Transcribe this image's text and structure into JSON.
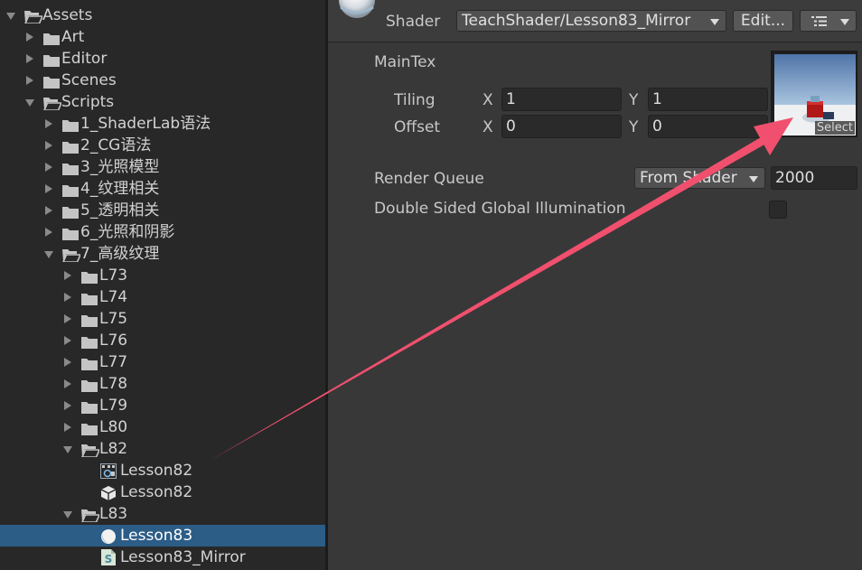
{
  "tree": [
    {
      "label": "Assets",
      "depth": 0,
      "expand": "down",
      "icon": "folder-open-icon",
      "type": "folder-open"
    },
    {
      "label": "Art",
      "depth": 1,
      "expand": "right",
      "icon": "folder-icon",
      "type": "folder"
    },
    {
      "label": "Editor",
      "depth": 1,
      "expand": "right",
      "icon": "folder-icon",
      "type": "folder"
    },
    {
      "label": "Scenes",
      "depth": 1,
      "expand": "right",
      "icon": "folder-icon",
      "type": "folder"
    },
    {
      "label": "Scripts",
      "depth": 1,
      "expand": "down",
      "icon": "folder-open-icon",
      "type": "folder-open"
    },
    {
      "label": "1_ShaderLab语法",
      "depth": 2,
      "expand": "right",
      "icon": "folder-icon",
      "type": "folder"
    },
    {
      "label": "2_CG语法",
      "depth": 2,
      "expand": "right",
      "icon": "folder-icon",
      "type": "folder"
    },
    {
      "label": "3_光照模型",
      "depth": 2,
      "expand": "right",
      "icon": "folder-icon",
      "type": "folder"
    },
    {
      "label": "4_纹理相关",
      "depth": 2,
      "expand": "right",
      "icon": "folder-icon",
      "type": "folder"
    },
    {
      "label": "5_透明相关",
      "depth": 2,
      "expand": "right",
      "icon": "folder-icon",
      "type": "folder"
    },
    {
      "label": "6_光照和阴影",
      "depth": 2,
      "expand": "right",
      "icon": "folder-icon",
      "type": "folder"
    },
    {
      "label": "7_高级纹理",
      "depth": 2,
      "expand": "down",
      "icon": "folder-open-icon",
      "type": "folder-open"
    },
    {
      "label": "L73",
      "depth": 3,
      "expand": "right",
      "icon": "folder-icon",
      "type": "folder"
    },
    {
      "label": "L74",
      "depth": 3,
      "expand": "right",
      "icon": "folder-icon",
      "type": "folder"
    },
    {
      "label": "L75",
      "depth": 3,
      "expand": "right",
      "icon": "folder-icon",
      "type": "folder"
    },
    {
      "label": "L76",
      "depth": 3,
      "expand": "right",
      "icon": "folder-icon",
      "type": "folder"
    },
    {
      "label": "L77",
      "depth": 3,
      "expand": "right",
      "icon": "folder-icon",
      "type": "folder"
    },
    {
      "label": "L78",
      "depth": 3,
      "expand": "right",
      "icon": "folder-icon",
      "type": "folder"
    },
    {
      "label": "L79",
      "depth": 3,
      "expand": "right",
      "icon": "folder-icon",
      "type": "folder"
    },
    {
      "label": "L80",
      "depth": 3,
      "expand": "right",
      "icon": "folder-icon",
      "type": "folder"
    },
    {
      "label": "L82",
      "depth": 3,
      "expand": "down",
      "icon": "folder-open-icon",
      "type": "folder-open"
    },
    {
      "label": "Lesson82",
      "depth": 4,
      "expand": "none",
      "icon": "scene-icon",
      "type": "scene"
    },
    {
      "label": "Lesson82",
      "depth": 4,
      "expand": "none",
      "icon": "prefab-cube-icon",
      "type": "cube"
    },
    {
      "label": "L83",
      "depth": 3,
      "expand": "down",
      "icon": "folder-open-icon",
      "type": "folder-open"
    },
    {
      "label": "Lesson83",
      "depth": 4,
      "expand": "none",
      "icon": "material-sphere-icon",
      "type": "sphere",
      "selected": true
    },
    {
      "label": "Lesson83_Mirror",
      "depth": 4,
      "expand": "none",
      "icon": "shader-file-icon",
      "type": "shader"
    }
  ],
  "inspector": {
    "shader_label": "Shader",
    "shader_value": "TeachShader/Lesson83_Mirror",
    "edit_button": "Edit...",
    "menu_icon": "list-menu-icon",
    "maintex_label": "MainTex",
    "tiling_label": "Tiling",
    "offset_label": "Offset",
    "x_label": "X",
    "y_label": "Y",
    "tiling_x": "1",
    "tiling_y": "1",
    "offset_x": "0",
    "offset_y": "0",
    "select_label": "Select",
    "render_queue_label": "Render Queue",
    "render_queue_dropdown": "From Shader",
    "render_queue_value": "2000",
    "double_sided_label": "Double Sided Global Illumination",
    "double_sided_checked": false
  },
  "colors": {
    "selection": "#2c5d87",
    "annotation_arrow": "#f0506e"
  }
}
